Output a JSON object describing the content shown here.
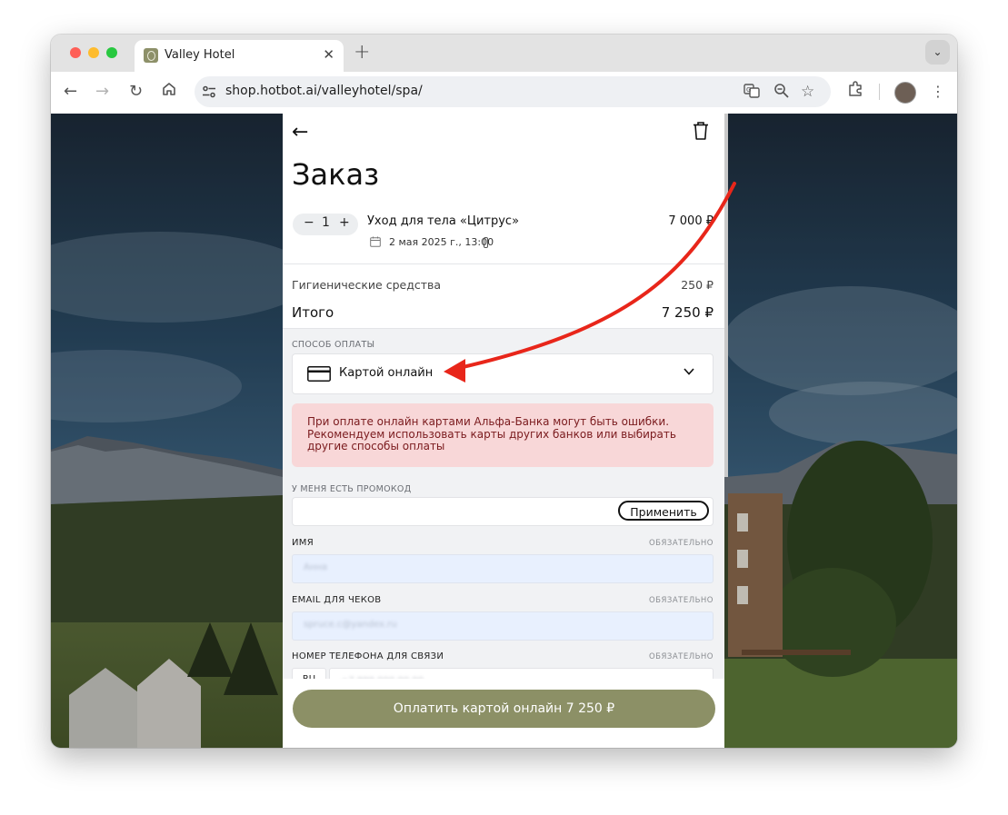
{
  "browser": {
    "tab_title": "Valley Hotel",
    "tab_close": "✕",
    "new_tab": "+",
    "tab_menu": "⌄",
    "url": "shop.hotbot.ai/valleyhotel/spa/"
  },
  "order": {
    "title": "Заказ",
    "item": {
      "quantity": "1",
      "minus": "−",
      "plus": "+",
      "name": "Уход для тела «Цитрус»",
      "price": "7 000 ₽",
      "date": "2 мая 2025 г., 13:00"
    },
    "hygiene_label": "Гигиенические средства",
    "hygiene_price": "250 ₽",
    "total_label": "Итого",
    "total_price": "7 250 ₽"
  },
  "payment": {
    "section_label": "СПОСОБ ОПЛАТЫ",
    "selected": "Картой онлайн",
    "alert": "При оплате онлайн картами Альфа-Банка могут быть ошибки. Рекомендуем использовать карты других банков или выбирать другие способы оплаты"
  },
  "promo": {
    "label": "У МЕНЯ ЕСТЬ ПРОМОКОД",
    "apply_button": "Применить"
  },
  "form": {
    "required_text": "ОБЯЗАТЕЛЬНО",
    "name_label": "ИМЯ",
    "name_value": "Анна",
    "email_label": "EMAIL ДЛЯ ЧЕКОВ",
    "email_value": "spruce.c@yandex.ru",
    "phone_label": "НОМЕР ТЕЛЕФОНА ДЛЯ СВЯЗИ",
    "phone_country": "RU",
    "phone_value": "+7 999 000 00 00"
  },
  "pay_button": "Оплатить картой онлайн 7 250 ₽",
  "colors": {
    "accent": "#8c9066",
    "alert_bg": "#f8d7d8",
    "alert_text": "#7a1a1d",
    "annotation_arrow": "#e8261a"
  }
}
